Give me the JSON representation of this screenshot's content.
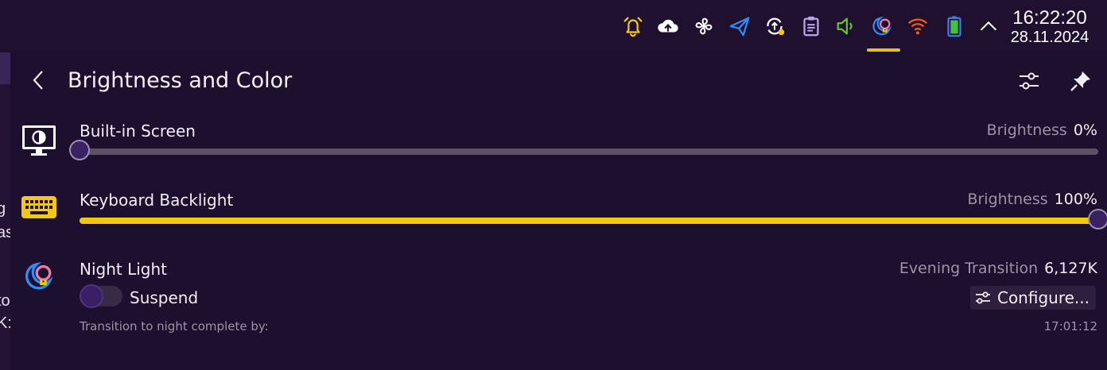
{
  "tray": {
    "icons": [
      "alarm-bell-icon",
      "cloud-upload-icon",
      "fan-icon",
      "send-icon",
      "update-icon",
      "clipboard-icon",
      "volume-icon",
      "night-light-icon",
      "wifi-icon",
      "battery-icon",
      "chevron-up-icon"
    ],
    "time": "16:22:20",
    "date": "28.11.2024"
  },
  "background_window": {
    "fragments": [
      "g",
      "as",
      "to",
      "K:"
    ]
  },
  "panel": {
    "title": "Brightness and Color",
    "back_icon": "chevron-left-icon",
    "settings_icon": "sliders-icon",
    "pin_icon": "pin-icon"
  },
  "screen": {
    "label": "Built-in Screen",
    "value_label": "Brightness",
    "value": "0%",
    "level": 0,
    "icon": "monitor-icon"
  },
  "keyboard": {
    "label": "Keyboard Backlight",
    "value_label": "Brightness",
    "value": "100%",
    "level": 100,
    "icon": "keyboard-icon"
  },
  "night_light": {
    "label": "Night Light",
    "value_label": "Evening Transition",
    "value": "6,127K",
    "toggle_label": "Suspend",
    "toggle_on": false,
    "configure_label": "Configure...",
    "footnote": "Transition to night complete by:",
    "footnote_time": "17:01:12",
    "icon": "night-light-icon"
  },
  "colors": {
    "accent": "#f3c80e",
    "background": "#1d0f2e",
    "track": "#5b5266"
  }
}
